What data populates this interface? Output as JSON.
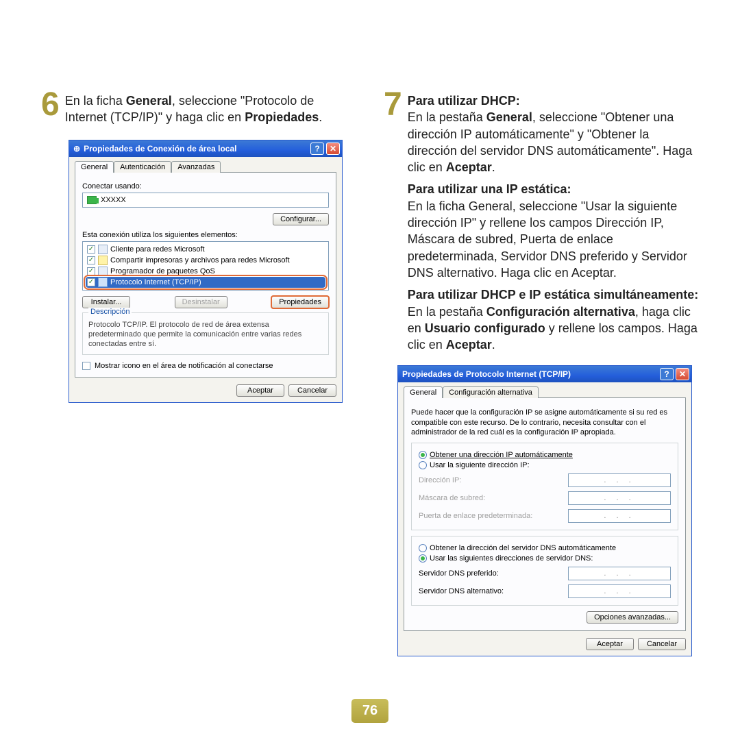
{
  "step6": {
    "num": "6",
    "text_a": "En la ficha ",
    "bold_a": "General",
    "text_b": ", seleccione \"Protocolo de Internet (TCP/IP)\" y haga clic en ",
    "bold_b": "Propiedades",
    "text_c": "."
  },
  "step7": {
    "num": "7",
    "h1": "Para utilizar DHCP:",
    "p1_a": "En la pestaña ",
    "p1_b1": "General",
    "p1_c": ", seleccione \"Obtener una dirección IP automáticamente\" y \"Obtener la dirección del servidor DNS automáticamente\". Haga clic en ",
    "p1_b2": "Aceptar",
    "p1_d": ".",
    "h2": "Para utilizar una IP estática:",
    "p2": "En la ficha General, seleccione \"Usar la siguiente dirección IP\" y rellene los campos Dirección IP, Máscara de subred, Puerta de enlace predeterminada, Servidor DNS preferido y Servidor DNS alternativo. Haga clic en Aceptar.",
    "h3": "Para utilizar DHCP e IP estática simultáneamente:",
    "p3_a": "En la pestaña ",
    "p3_b1": "Configuración alternativa",
    "p3_c": ", haga clic en ",
    "p3_b2": "Usuario configurado",
    "p3_d": " y rellene los campos. Haga clic en ",
    "p3_b3": "Aceptar",
    "p3_e": "."
  },
  "win1": {
    "title": "Propiedades de Conexión de área local",
    "tabs": {
      "general": "General",
      "auth": "Autenticación",
      "adv": "Avanzadas"
    },
    "connect_using": "Conectar usando:",
    "nic": "XXXXX",
    "configure": "Configurar...",
    "uses_items": "Esta conexión utiliza los siguientes elementos:",
    "items": [
      "Cliente para redes Microsoft",
      "Compartir impresoras y archivos para redes Microsoft",
      "Programador de paquetes QoS",
      "Protocolo Internet (TCP/IP)"
    ],
    "install": "Instalar...",
    "uninstall": "Desinstalar",
    "properties": "Propiedades",
    "desc_title": "Descripción",
    "desc": "Protocolo TCP/IP. El protocolo de red de área extensa predeterminado que permite la comunicación entre varias redes conectadas entre sí.",
    "show_icon": "Mostrar icono en el área de notificación al conectarse",
    "ok": "Aceptar",
    "cancel": "Cancelar"
  },
  "win2": {
    "title": "Propiedades de Protocolo Internet (TCP/IP)",
    "tabs": {
      "general": "General",
      "alt": "Configuración alternativa"
    },
    "intro": "Puede hacer que la configuración IP se asigne automáticamente si su red es compatible con este recurso. De lo contrario, necesita consultar con el administrador de la red cuál es la configuración IP apropiada.",
    "r_auto_ip": "Obtener una dirección IP automáticamente",
    "r_static_ip": "Usar la siguiente dirección IP:",
    "ip": "Dirección IP:",
    "mask": "Máscara de subred:",
    "gw": "Puerta de enlace predeterminada:",
    "r_auto_dns": "Obtener la dirección del servidor DNS automáticamente",
    "r_static_dns": "Usar las siguientes direcciones de servidor DNS:",
    "dns1": "Servidor DNS preferido:",
    "dns2": "Servidor DNS alternativo:",
    "adv": "Opciones avanzadas...",
    "ok": "Aceptar",
    "cancel": "Cancelar",
    "dots": ".   .   ."
  },
  "check": "✓",
  "pagenum": "76"
}
